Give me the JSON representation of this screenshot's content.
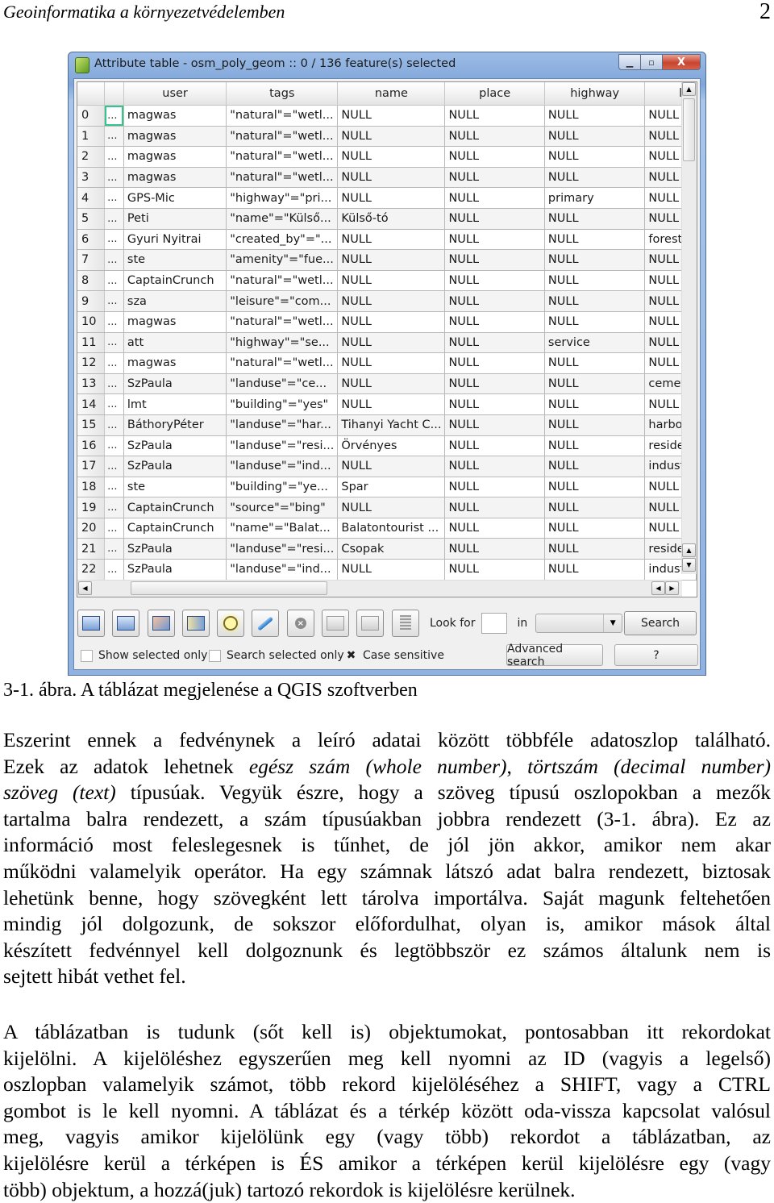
{
  "running_head": {
    "title": "Geoinformatika a környezetvédelemben",
    "page_number": "2"
  },
  "window": {
    "title": "Attribute table - osm_poly_geom :: 0 / 136 feature(s) selected",
    "icons": {
      "app": "qgis-logo-icon",
      "minimize": "minimize-icon",
      "maximize": "maximize-icon",
      "close": "close-icon"
    },
    "caption_glyphs": {
      "minimize": "▁",
      "maximize": "▫",
      "close": "X"
    }
  },
  "table": {
    "columns": [
      "",
      "",
      "user",
      "tags",
      "name",
      "place",
      "highway",
      "lar"
    ],
    "rows": [
      {
        "id": "0",
        "ell": "...",
        "user": "magwas",
        "tags": "\"natural\"=\"wetl...",
        "name": "NULL",
        "place": "NULL",
        "highway": "NULL",
        "land": "NULL"
      },
      {
        "id": "1",
        "ell": "...",
        "user": "magwas",
        "tags": "\"natural\"=\"wetl...",
        "name": "NULL",
        "place": "NULL",
        "highway": "NULL",
        "land": "NULL"
      },
      {
        "id": "2",
        "ell": "...",
        "user": "magwas",
        "tags": "\"natural\"=\"wetl...",
        "name": "NULL",
        "place": "NULL",
        "highway": "NULL",
        "land": "NULL"
      },
      {
        "id": "3",
        "ell": "...",
        "user": "magwas",
        "tags": "\"natural\"=\"wetl...",
        "name": "NULL",
        "place": "NULL",
        "highway": "NULL",
        "land": "NULL"
      },
      {
        "id": "4",
        "ell": "...",
        "user": "GPS-Mic",
        "tags": "\"highway\"=\"pri...",
        "name": "NULL",
        "place": "NULL",
        "highway": "primary",
        "land": "NULL"
      },
      {
        "id": "5",
        "ell": "...",
        "user": "Peti",
        "tags": "\"name\"=\"Külső...",
        "name": "Külső-tó",
        "place": "NULL",
        "highway": "NULL",
        "land": "NULL"
      },
      {
        "id": "6",
        "ell": "...",
        "user": "Gyuri Nyitrai",
        "tags": "\"created_by\"=\"...",
        "name": "NULL",
        "place": "NULL",
        "highway": "NULL",
        "land": "forest"
      },
      {
        "id": "7",
        "ell": "...",
        "user": "ste",
        "tags": "\"amenity\"=\"fue...",
        "name": "NULL",
        "place": "NULL",
        "highway": "NULL",
        "land": "NULL"
      },
      {
        "id": "8",
        "ell": "...",
        "user": "CaptainCrunch",
        "tags": "\"natural\"=\"wetl...",
        "name": "NULL",
        "place": "NULL",
        "highway": "NULL",
        "land": "NULL"
      },
      {
        "id": "9",
        "ell": "...",
        "user": "sza",
        "tags": "\"leisure\"=\"com...",
        "name": "NULL",
        "place": "NULL",
        "highway": "NULL",
        "land": "NULL"
      },
      {
        "id": "10",
        "ell": "...",
        "user": "magwas",
        "tags": "\"natural\"=\"wetl...",
        "name": "NULL",
        "place": "NULL",
        "highway": "NULL",
        "land": "NULL"
      },
      {
        "id": "11",
        "ell": "...",
        "user": "att",
        "tags": "\"highway\"=\"se...",
        "name": "NULL",
        "place": "NULL",
        "highway": "service",
        "land": "NULL"
      },
      {
        "id": "12",
        "ell": "...",
        "user": "magwas",
        "tags": "\"natural\"=\"wetl...",
        "name": "NULL",
        "place": "NULL",
        "highway": "NULL",
        "land": "NULL"
      },
      {
        "id": "13",
        "ell": "...",
        "user": "SzPaula",
        "tags": "\"landuse\"=\"ce...",
        "name": "NULL",
        "place": "NULL",
        "highway": "NULL",
        "land": "cemete"
      },
      {
        "id": "14",
        "ell": "...",
        "user": "lmt",
        "tags": "\"building\"=\"yes\"",
        "name": "NULL",
        "place": "NULL",
        "highway": "NULL",
        "land": "NULL"
      },
      {
        "id": "15",
        "ell": "...",
        "user": "BáthoryPéter",
        "tags": "\"landuse\"=\"har...",
        "name": "Tihanyi Yacht C...",
        "place": "NULL",
        "highway": "NULL",
        "land": "harbor"
      },
      {
        "id": "16",
        "ell": "...",
        "user": "SzPaula",
        "tags": "\"landuse\"=\"resi...",
        "name": "Örvényes",
        "place": "NULL",
        "highway": "NULL",
        "land": "residen"
      },
      {
        "id": "17",
        "ell": "...",
        "user": "SzPaula",
        "tags": "\"landuse\"=\"ind...",
        "name": "NULL",
        "place": "NULL",
        "highway": "NULL",
        "land": "industr"
      },
      {
        "id": "18",
        "ell": "...",
        "user": "ste",
        "tags": "\"building\"=\"ye...",
        "name": "Spar",
        "place": "NULL",
        "highway": "NULL",
        "land": "NULL"
      },
      {
        "id": "19",
        "ell": "...",
        "user": "CaptainCrunch",
        "tags": "\"source\"=\"bing\"",
        "name": "NULL",
        "place": "NULL",
        "highway": "NULL",
        "land": "NULL"
      },
      {
        "id": "20",
        "ell": "...",
        "user": "CaptainCrunch",
        "tags": "\"name\"=\"Balat...",
        "name": "Balatontourist ...",
        "place": "NULL",
        "highway": "NULL",
        "land": "NULL"
      },
      {
        "id": "21",
        "ell": "...",
        "user": "SzPaula",
        "tags": "\"landuse\"=\"resi...",
        "name": "Csopak",
        "place": "NULL",
        "highway": "NULL",
        "land": "residen"
      },
      {
        "id": "22",
        "ell": "...",
        "user": "SzPaula",
        "tags": "\"landuse\"=\"ind...",
        "name": "NULL",
        "place": "NULL",
        "highway": "NULL",
        "land": "industr"
      }
    ],
    "scroll_glyphs": {
      "up": "▲",
      "down": "▼",
      "left": "◀",
      "right": "▶"
    }
  },
  "toolbar": {
    "buttons": [
      {
        "name": "unselect-all-button",
        "icon": "table-icon"
      },
      {
        "name": "select-all-button",
        "icon": "table-select-icon"
      },
      {
        "name": "invert-selection-button",
        "icon": "table-invert-icon"
      },
      {
        "name": "move-selected-to-top-button",
        "icon": "table-top-icon"
      },
      {
        "name": "pan-map-to-selected-button",
        "icon": "magnifier-icon"
      },
      {
        "name": "toggle-editing-button",
        "icon": "pencil-icon"
      },
      {
        "name": "delete-selected-button",
        "icon": "delete-circle-icon"
      },
      {
        "name": "new-column-button",
        "icon": "new-column-icon"
      },
      {
        "name": "delete-column-button",
        "icon": "delete-column-icon"
      },
      {
        "name": "field-calculator-button",
        "icon": "calculator-icon"
      }
    ],
    "look_for_label": "Look for",
    "look_for_value": "",
    "in_label": "in",
    "field_select_value": "",
    "search_label": "Search"
  },
  "options": {
    "show_selected_only": {
      "label": "Show selected only",
      "checked": false
    },
    "search_selected_only": {
      "label": "Search selected only",
      "checked": false
    },
    "case_sensitive": {
      "label": "Case sensitive",
      "checked": true,
      "mark": "✖"
    },
    "advanced_search_label": "Advanced search",
    "help_label": "?"
  },
  "caption": "3-1. ábra. A táblázat megjelenése a QGIS szoftverben",
  "paragraph1": {
    "l1": "Eszerint ennek a fedvénynek a leíró adatai között többféle adatoszlop található.",
    "l2a": "Ezek az adatok lehetnek ",
    "l2b": "egész szám (whole number)",
    "l2c": ", ",
    "l2d": "törtszám (decimal number)",
    "l3a": "szöveg (text)",
    "l3b": " típusúak. Vegyük észre, hogy a szöveg típusú oszlopokban a mezők",
    "l4": "tartalma balra rendezett, a szám típusúakban jobbra rendezett (3-1. ábra). Ez az",
    "l5": "információ most feleslegesnek is tűnhet, de jól jön akkor, amikor nem akar",
    "l6": "működni valamelyik operátor. Ha egy számnak látszó adat balra rendezett, biztosak",
    "l7": "lehetünk benne, hogy szövegként lett tárolva importálva. Saját magunk feltehetően",
    "l8": "mindig jól dolgozunk, de sokszor előfordulhat, olyan is, amikor mások által",
    "l9": "készített fedvénnyel kell dolgoznunk és legtöbbször ez számos általunk nem is",
    "l10": "sejtett hibát vethet fel."
  },
  "paragraph2": {
    "l1": "A táblázatban is tudunk (sőt kell is) objektumokat, pontosabban itt rekordokat",
    "l2": "kijelölni. A kijelöléshez egyszerűen meg kell nyomni az ID (vagyis a legelső)",
    "l3": "oszlopban valamelyik számot, több rekord kijelöléséhez a SHIFT, vagy a CTRL",
    "l4": "gombot is le kell nyomni. A táblázat és a térkép között oda-vissza kapcsolat valósul",
    "l5": "meg, vagyis amikor kijelölünk egy (vagy több) rekordot a táblázatban, az",
    "l6": "kijelölésre kerül a térképen is ÉS amikor a térképen kerül kijelölésre egy (vagy",
    "l7": "több) objektum, a hozzá(juk) tartozó rekordok is kijelölésre kerülnek."
  }
}
